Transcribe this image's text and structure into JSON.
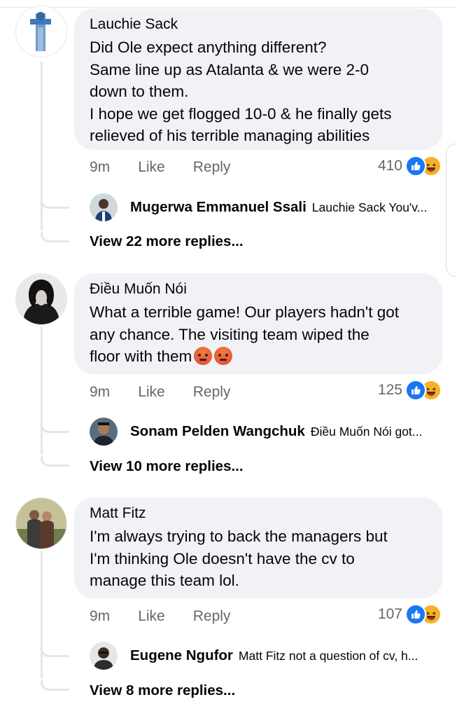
{
  "comments": [
    {
      "author": "Lauchie Sack",
      "lines": [
        "Did Ole expect anything different?",
        "Same line up as Atalanta & we were 2-0",
        "down to them.",
        "I hope we get flogged 10-0 & he finally gets",
        "relieved of his terrible managing abilities"
      ],
      "time": "9m",
      "like_label": "Like",
      "reply_label": "Reply",
      "reaction_count": "410",
      "reply_preview": {
        "author": "Mugerwa Emmanuel Ssali",
        "text": "Lauchie Sack You'v..."
      },
      "more_replies": "View 22 more replies..."
    },
    {
      "author": "Điều Muốn Nói",
      "lines": [
        "What a terrible game! Our players hadn't got",
        "any chance. The visiting team wiped the",
        "floor with them"
      ],
      "time": "9m",
      "like_label": "Like",
      "reply_label": "Reply",
      "reaction_count": "125",
      "reply_preview": {
        "author": "Sonam Pelden Wangchuk",
        "text": "Điều Muốn Nói  got..."
      },
      "more_replies": "View 10 more replies..."
    },
    {
      "author": "Matt Fitz",
      "lines": [
        "I'm always trying to back the managers but",
        "I'm thinking Ole doesn't have the cv to",
        "manage this team lol."
      ],
      "time": "9m",
      "like_label": "Like",
      "reply_label": "Reply",
      "reaction_count": "107",
      "reply_preview": {
        "author": "Eugene Ngufor",
        "text": "Matt Fitz  not a question of cv, h..."
      },
      "more_replies": "View 8 more replies..."
    }
  ],
  "icons": {
    "like_reaction": "like-reaction-icon",
    "haha_reaction": "haha-reaction-icon",
    "angry_emoji": "angry-emoji-icon"
  },
  "colors": {
    "bubble": "#f0f2f5",
    "meta_text": "#65676b",
    "like_blue": "#1877f2",
    "haha_yellow": "#f7b125"
  }
}
